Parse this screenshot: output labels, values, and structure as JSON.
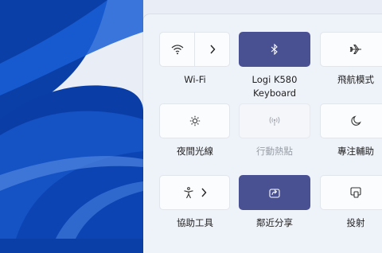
{
  "tiles": [
    {
      "label": "Wi-Fi",
      "icon": "wifi-icon",
      "state": "off",
      "has_arrow": true
    },
    {
      "label": "Logi K580\nKeyboard",
      "label_line1": "Logi K580",
      "label_line2": "Keyboard",
      "icon": "bluetooth-icon",
      "state": "on"
    },
    {
      "label": "飛航模式",
      "icon": "airplane-icon",
      "state": "off"
    },
    {
      "label": "夜間光線",
      "icon": "brightness-icon",
      "state": "off"
    },
    {
      "label": "行動熱點",
      "icon": "hotspot-icon",
      "state": "disabled"
    },
    {
      "label": "專注輔助",
      "icon": "moon-icon",
      "state": "off"
    },
    {
      "label": "協助工具",
      "icon": "accessibility-icon",
      "state": "off",
      "has_arrow": true
    },
    {
      "label": "鄰近分享",
      "icon": "share-icon",
      "state": "on"
    },
    {
      "label": "投射",
      "icon": "cast-icon",
      "state": "off"
    }
  ],
  "colors": {
    "accent": "#4a5193",
    "panel": "#eef2f9",
    "wallpaper": "#0b3fa8"
  }
}
